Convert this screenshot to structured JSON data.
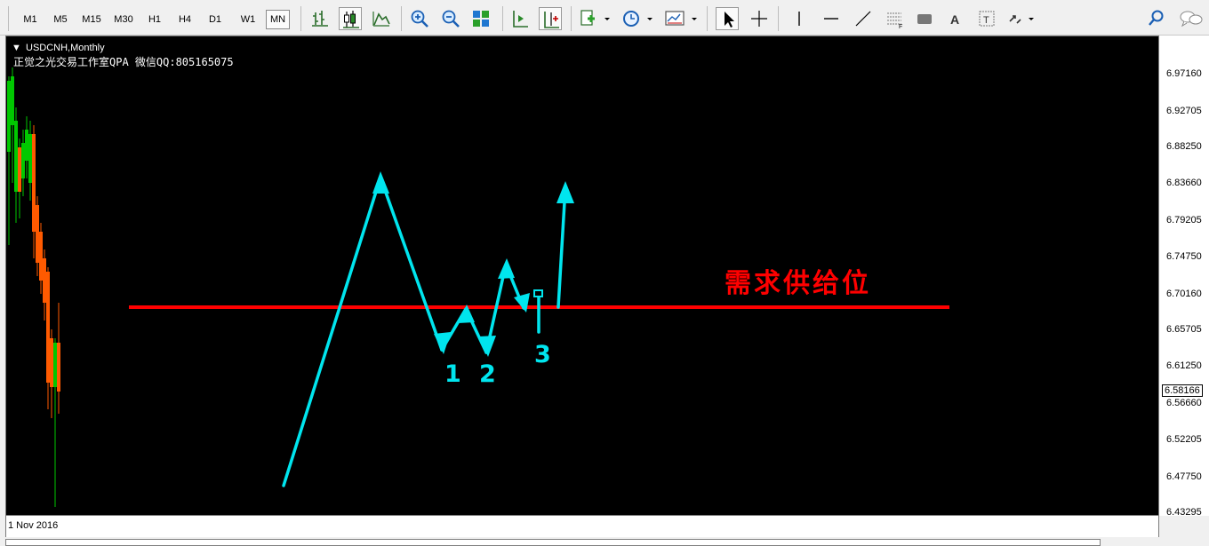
{
  "toolbar": {
    "timeframes": [
      "M1",
      "M5",
      "M15",
      "M30",
      "H1",
      "H4",
      "D1",
      "W1",
      "MN"
    ],
    "active_timeframe": "MN"
  },
  "chart": {
    "symbol_label": "USDCNH,Monthly",
    "watermark": "正觉之光交易工作室QPA 微信QQ:805165075",
    "annotation": "需求供给位",
    "wave_labels": [
      "1",
      "2",
      "3"
    ],
    "time_label": "1 Nov 2016",
    "current_price": "6.58166",
    "price_levels": [
      "6.97160",
      "6.92705",
      "6.88250",
      "6.83660",
      "6.79205",
      "6.74750",
      "6.70160",
      "6.65705",
      "6.61250",
      "6.56660",
      "6.52205",
      "6.47750",
      "6.43295"
    ]
  },
  "colors": {
    "background": "#000000",
    "level_line": "#ff0000",
    "arrows": "#00e5ee",
    "bull_candle": "#00c800",
    "bear_candle": "#ff5a00"
  }
}
